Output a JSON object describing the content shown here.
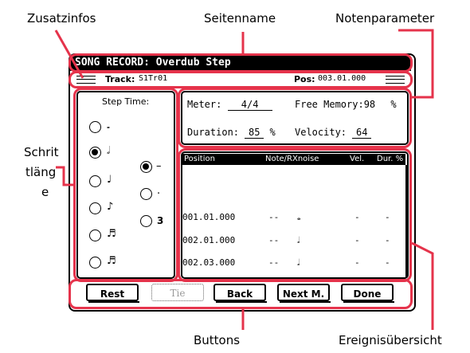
{
  "callouts": {
    "zusatzinfos": "Zusatzinfos",
    "seitenname": "Seitenname",
    "notenparameter": "Notenparameter",
    "schrittlaenge": [
      "Schrit",
      "tläng",
      "e"
    ],
    "buttons": "Buttons",
    "ereignisuebersicht": "Ereignisübersicht"
  },
  "screen": {
    "title": "SONG RECORD: Overdub Step",
    "track_label": "Track:",
    "track_value": "S1Tr01",
    "pos_label": "Pos:",
    "pos_value": "003.01.000"
  },
  "step_time": {
    "label": "Step Time:",
    "selected_note": "half",
    "selected_modifier": "normal"
  },
  "params": {
    "meter_label": "Meter:",
    "meter_value": "4/4",
    "free_memory_label": "Free Memory:",
    "free_memory_value": "98",
    "free_memory_unit": "%",
    "duration_label": "Duration:",
    "duration_value": "85",
    "duration_unit": "%",
    "velocity_label": "Velocity:",
    "velocity_value": "64"
  },
  "events": {
    "columns": [
      "Position",
      "Note/RXnoise",
      "Vel.",
      "Dur. %"
    ],
    "rows": [
      {
        "position": "001.01.000",
        "dash": "--",
        "vel": "-",
        "dur": "-",
        "note_icon": "whole-note"
      },
      {
        "position": "002.01.000",
        "dash": "--",
        "vel": "-",
        "dur": "-",
        "note_icon": "half-note"
      },
      {
        "position": "002.03.000",
        "dash": "--",
        "vel": "-",
        "dur": "-",
        "note_icon": "half-note"
      }
    ]
  },
  "buttons": {
    "rest": "Rest",
    "tie": "Tie",
    "back": "Back",
    "next": "Next M.",
    "done": "Done"
  },
  "glyphs": {
    "modifier_dotted": ".",
    "modifier_triplet": "3",
    "modifier_normal": "–"
  }
}
